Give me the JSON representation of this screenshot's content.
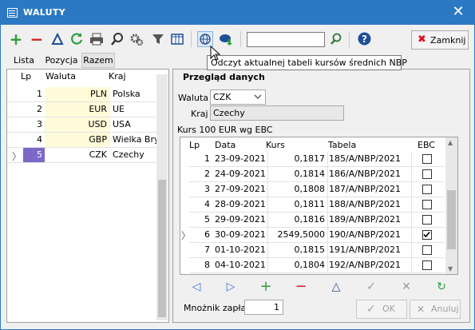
{
  "window": {
    "title": "WALUTY",
    "close_glyph": "✕"
  },
  "toolbar": {
    "close_label": "Zamknij",
    "icons": [
      "plus-icon",
      "minus-icon",
      "triangle-icon",
      "refresh-icon",
      "printer-icon",
      "search-icon",
      "gears-icon",
      "filter-icon",
      "columns-icon",
      "globe-icon",
      "cloud-download-icon",
      "search-go-icon",
      "help-icon"
    ]
  },
  "tooltip": "Odczyt aktualnej tabeli kursów średnich NBP",
  "tabs": [
    "Lista",
    "Pozycja",
    "Razem"
  ],
  "currency_list": {
    "headers": {
      "lp": "Lp",
      "currency": "Waluta",
      "country": "Kraj"
    },
    "rows": [
      {
        "lp": "1",
        "code": "PLN",
        "country": "Polska"
      },
      {
        "lp": "2",
        "code": "EUR",
        "country": "UE"
      },
      {
        "lp": "3",
        "code": "USD",
        "country": "USA"
      },
      {
        "lp": "4",
        "code": "GBP",
        "country": "Wielka Brytania"
      },
      {
        "lp": "5",
        "code": "CZK",
        "country": "Czechy"
      }
    ],
    "selected_index": 4
  },
  "detail": {
    "group_title": "Przegląd danych",
    "currency_label": "Waluta",
    "currency_value": "CZK",
    "country_label": "Kraj",
    "country_value": "Czechy",
    "rate_caption": "Kurs 100 EUR wg EBC"
  },
  "rates": {
    "headers": {
      "lp": "Lp",
      "date": "Data",
      "rate": "Kurs",
      "table": "Tabela",
      "ebc": "EBC"
    },
    "rows": [
      {
        "lp": "1",
        "date": "23-09-2021",
        "rate": "0,1817",
        "table": "185/A/NBP/2021",
        "ebc": false
      },
      {
        "lp": "2",
        "date": "24-09-2021",
        "rate": "0,1814",
        "table": "186/A/NBP/2021",
        "ebc": false
      },
      {
        "lp": "3",
        "date": "27-09-2021",
        "rate": "0,1808",
        "table": "187/A/NBP/2021",
        "ebc": false
      },
      {
        "lp": "4",
        "date": "28-09-2021",
        "rate": "0,1811",
        "table": "188/A/NBP/2021",
        "ebc": false
      },
      {
        "lp": "5",
        "date": "29-09-2021",
        "rate": "0,1816",
        "table": "189/A/NBP/2021",
        "ebc": false
      },
      {
        "lp": "6",
        "date": "30-09-2021",
        "rate": "2549,5000",
        "table": "190/A/NBP/2021",
        "ebc": true
      },
      {
        "lp": "7",
        "date": "01-10-2021",
        "rate": "0,1815",
        "table": "191/A/NBP/2021",
        "ebc": false
      },
      {
        "lp": "8",
        "date": "04-10-2021",
        "rate": "0,1804",
        "table": "192/A/NBP/2021",
        "ebc": false
      }
    ],
    "current_index": 5
  },
  "footer": {
    "multiplier_label": "Mnożnik zapłat",
    "multiplier_value": "1",
    "ok_label": "OK",
    "cancel_label": "Anuluj"
  },
  "colors": {
    "titlebar": "#2b79c2",
    "selection": "#7c68c7",
    "highlight": "#fffbd9",
    "add": "#2e9e3a",
    "remove": "#d12020"
  }
}
